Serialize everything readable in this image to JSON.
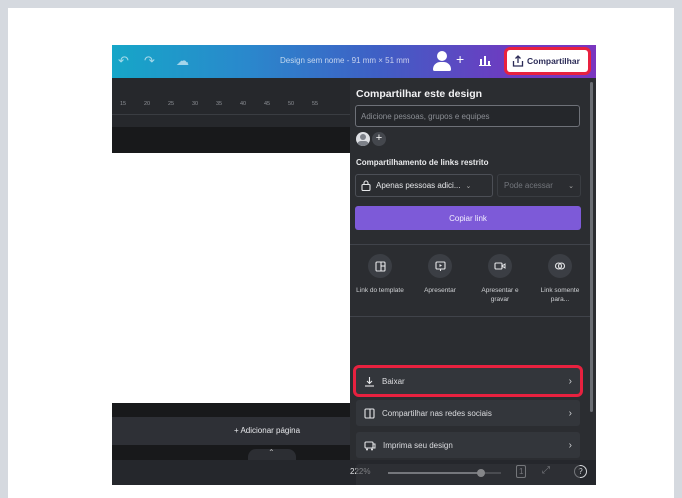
{
  "topbar": {
    "title": "Design sem nome - 91 mm × 51 mm",
    "share_label": "Compartilhar"
  },
  "ruler": {
    "ticks": [
      "15",
      "20",
      "25",
      "30",
      "35",
      "40",
      "45",
      "50",
      "55"
    ]
  },
  "canvas": {
    "add_page_label": "+ Adicionar página"
  },
  "bottombar": {
    "zoom": "222%",
    "page_number": "1",
    "zoom_fraction": 0.82
  },
  "panel": {
    "title": "Compartilhar este design",
    "people_placeholder": "Adicione pessoas, grupos e equipes",
    "link_section_label": "Compartilhamento de links restrito",
    "access_select": "Apenas pessoas adici...",
    "permission_select": "Pode acessar",
    "copy_link": "Copiar link",
    "options": [
      {
        "label": "Link do template",
        "icon": "template-icon"
      },
      {
        "label": "Apresentar",
        "icon": "present-icon"
      },
      {
        "label": "Apresentar e gravar",
        "icon": "record-icon"
      },
      {
        "label": "Link somente para...",
        "icon": "view-link-icon"
      }
    ],
    "rows": [
      {
        "label": "Baixar",
        "icon": "download-icon"
      },
      {
        "label": "Compartilhar nas redes sociais",
        "icon": "social-icon"
      },
      {
        "label": "Imprima seu design",
        "icon": "print-icon"
      }
    ]
  },
  "colors": {
    "highlight": "#e8213f",
    "accent": "#7d5ad8",
    "panel": "#2b2d31"
  }
}
